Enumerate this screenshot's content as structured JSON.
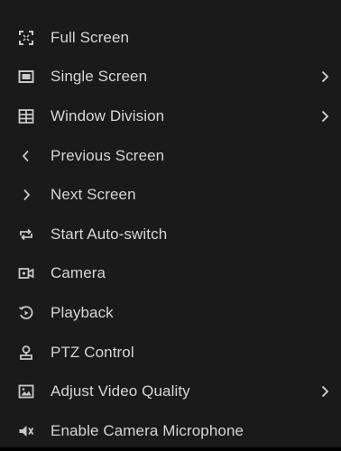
{
  "menu": {
    "items": [
      {
        "label": "Full Screen",
        "icon": "fullscreen-icon",
        "has_submenu": false
      },
      {
        "label": "Single Screen",
        "icon": "single-screen-icon",
        "has_submenu": true
      },
      {
        "label": "Window Division",
        "icon": "window-division-icon",
        "has_submenu": true
      },
      {
        "label": "Previous Screen",
        "icon": "chevron-left-icon",
        "has_submenu": false
      },
      {
        "label": "Next Screen",
        "icon": "chevron-right-icon",
        "has_submenu": false
      },
      {
        "label": "Start Auto-switch",
        "icon": "auto-switch-icon",
        "has_submenu": false
      },
      {
        "label": "Camera",
        "icon": "camera-icon",
        "has_submenu": false
      },
      {
        "label": "Playback",
        "icon": "playback-icon",
        "has_submenu": false
      },
      {
        "label": "PTZ Control",
        "icon": "ptz-icon",
        "has_submenu": false
      },
      {
        "label": "Adjust Video Quality",
        "icon": "video-quality-icon",
        "has_submenu": true
      },
      {
        "label": "Enable Camera Microphone",
        "icon": "microphone-icon",
        "has_submenu": false
      }
    ]
  },
  "colors": {
    "background": "#1a1a1a",
    "text": "#d6d6d6",
    "icon": "#c8c8c8"
  }
}
